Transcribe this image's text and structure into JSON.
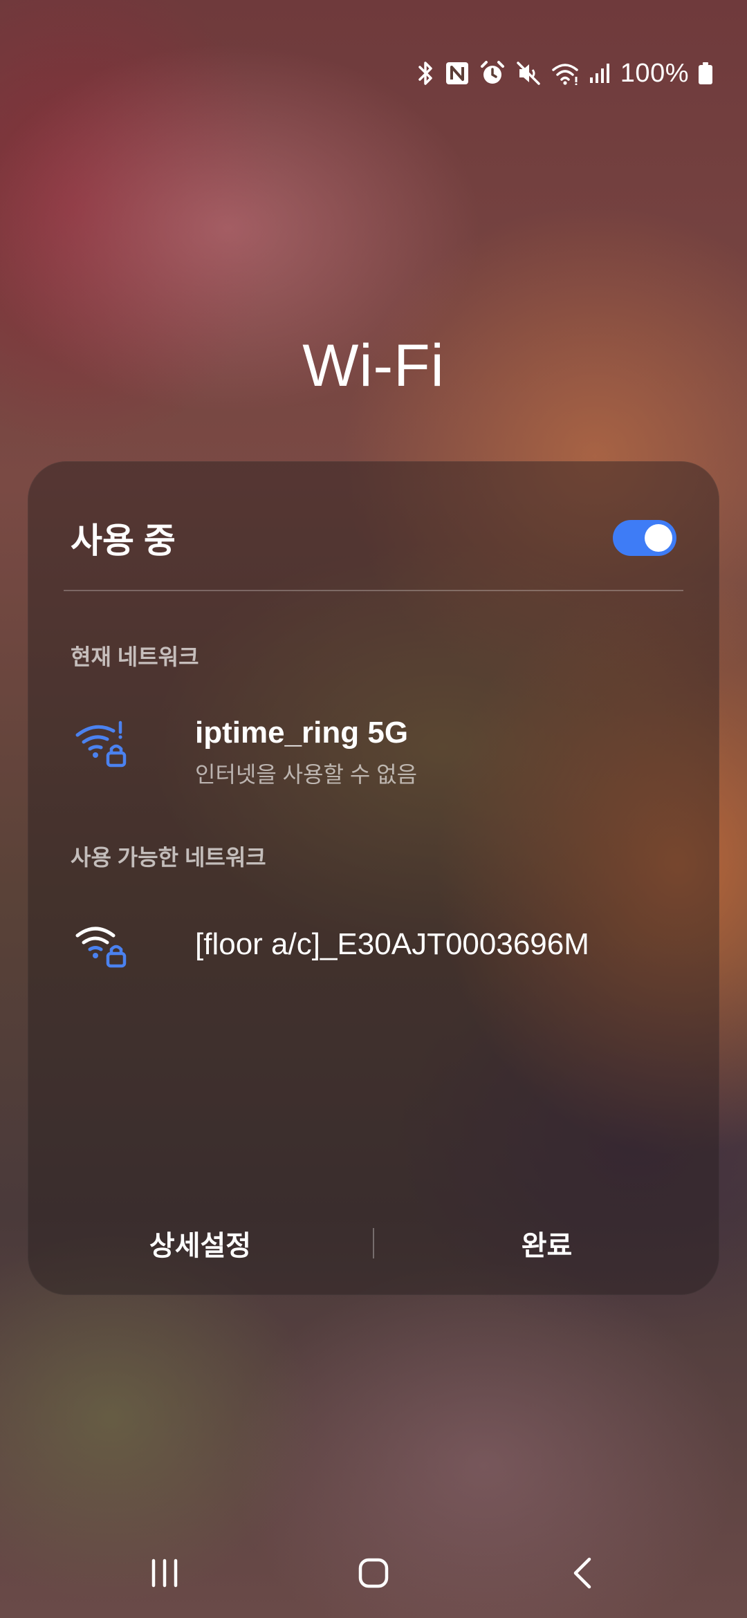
{
  "status_bar": {
    "icons": [
      "bluetooth-icon",
      "nfc-icon",
      "alarm-icon",
      "mute-icon",
      "wifi-icon",
      "signal-icon"
    ],
    "battery_text": "100%"
  },
  "page": {
    "title": "Wi-Fi"
  },
  "panel": {
    "status_label": "사용 중",
    "toggle_on": true,
    "accent_color": "#3e7cf6",
    "current_section_label": "현재 네트워크",
    "current_network": {
      "name": "iptime_ring 5G",
      "status": "인터넷을 사용할 수 없음",
      "icon": "wifi-lock-warning-icon"
    },
    "available_section_label": "사용 가능한 네트워크",
    "available_networks": [
      {
        "name": "[floor a/c]_E30AJT0003696M",
        "icon": "wifi-lock-icon"
      }
    ],
    "footer": {
      "advanced_label": "상세설정",
      "done_label": "완료"
    }
  },
  "nav_bar": {
    "buttons": [
      "recent-apps-icon",
      "home-icon",
      "back-icon"
    ]
  }
}
